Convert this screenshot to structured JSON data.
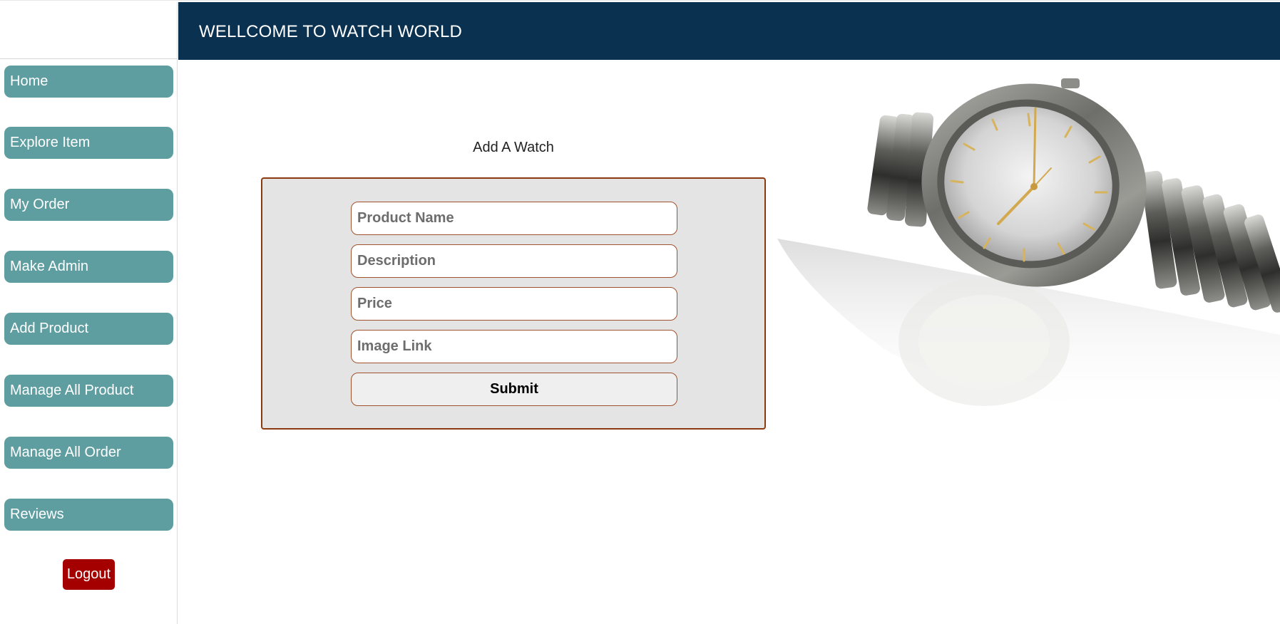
{
  "header": {
    "title": "WELLCOME TO WATCH WORLD"
  },
  "sidebar": {
    "items": [
      {
        "label": "Home"
      },
      {
        "label": "Explore Item"
      },
      {
        "label": "My Order"
      },
      {
        "label": "Make Admin"
      },
      {
        "label": "Add Product"
      },
      {
        "label": "Manage All Product"
      },
      {
        "label": "Manage All Order"
      },
      {
        "label": "Reviews"
      }
    ],
    "logout_label": "Logout"
  },
  "form": {
    "title": "Add A Watch",
    "fields": {
      "product_name": {
        "placeholder": "Product Name",
        "value": ""
      },
      "description": {
        "placeholder": "Description",
        "value": ""
      },
      "price": {
        "placeholder": "Price",
        "value": ""
      },
      "image_link": {
        "placeholder": "Image Link",
        "value": ""
      }
    },
    "submit_label": "Submit"
  },
  "colors": {
    "header_bg": "#0b3150",
    "nav_bg": "#5f9ea0",
    "logout_bg": "#a40000",
    "form_border": "#8b3a10",
    "form_bg": "#e4e4e4"
  },
  "icons": {
    "hero_image": "wristwatch-image"
  }
}
